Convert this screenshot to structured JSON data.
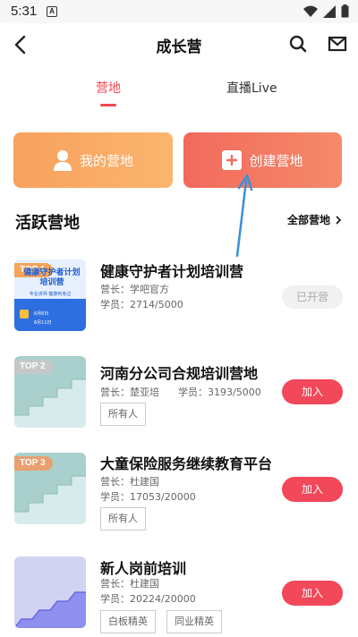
{
  "status_bar": {
    "time": "5:31",
    "notification_badge": "A"
  },
  "header": {
    "title": "成长营",
    "icons": [
      "back-arrow-icon",
      "search-icon",
      "mail-icon"
    ]
  },
  "tabs": [
    {
      "label": "营地",
      "active": true
    },
    {
      "label": "直播Live",
      "active": false
    }
  ],
  "actions": {
    "my_campus": "我的营地",
    "create_campus": "创建营地"
  },
  "section": {
    "title": "活跃营地",
    "more": "全部营地"
  },
  "camps": [
    {
      "rank": "TOP 1",
      "title": "健康守护者计划培训营",
      "leader": "营长：学吧官方",
      "members": "学员：2714/5000",
      "tags": [],
      "action": "已开营",
      "thumb_text": {
        "headline": "健康守护者计划培训营",
        "sub": "专业讲师  健康到身边",
        "line1": "6月6日",
        "line2": "6月11日"
      }
    },
    {
      "rank": "TOP 2",
      "title": "河南分公司合规培训营地",
      "leader": "营长：楚亚培",
      "members": "学员：3193/5000",
      "tags": [
        "所有人"
      ],
      "action": "加入"
    },
    {
      "rank": "TOP 3",
      "title": "大童保险服务继续教育平台",
      "leader": "营长：杜建国",
      "members": "学员：17053/20000",
      "tags": [
        "所有人"
      ],
      "action": "加入"
    },
    {
      "rank": "",
      "title": "新人岗前培训",
      "leader": "营长：杜建国",
      "members": "学员：20224/20000",
      "tags": [
        "白板精英",
        "同业精英"
      ],
      "action": "加入"
    }
  ],
  "colors": {
    "accent": "#f24952",
    "orange_start": "#f8a15f",
    "red_start": "#f26a5c"
  }
}
